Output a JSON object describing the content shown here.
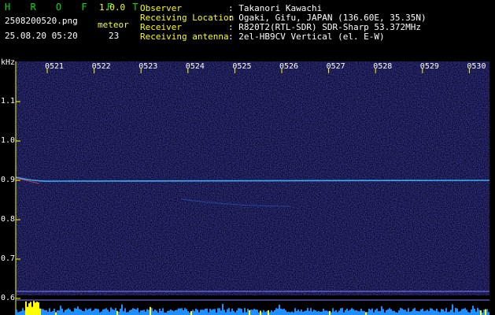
{
  "app": {
    "name": "H R O F F T",
    "version": "1.0.0"
  },
  "file": {
    "name": "2508200520.png",
    "datetime": "25.08.20 05:20"
  },
  "meteor": {
    "label": "meteor",
    "count": "23"
  },
  "info": {
    "labels": [
      "Observer",
      "Receiving Location",
      "Receiver",
      "Receiving antenna"
    ],
    "values": [
      ": Takanori Kawachi",
      ": Ogaki, Gifu, JAPAN (136.60E, 35.35N)",
      ": R820T2(RTL-SDR) SDR-Sharp 53.372MHz",
      ": 2el-HB9CV Vertical (el. E-W)"
    ]
  },
  "waterfall": {
    "unit": "kHz",
    "time_ticks": [
      "0521",
      "0522",
      "0523",
      "0524",
      "0525",
      "0526",
      "0527",
      "0528",
      "0529",
      "0530"
    ],
    "freq_ticks": [
      "1.1",
      "1.0",
      "0.9",
      "0.8",
      "0.7",
      "0.6"
    ],
    "freq_values": [
      1.1,
      1.0,
      0.9,
      0.8,
      0.7,
      0.6
    ],
    "colors": {
      "background": "#000000",
      "noise": "#18186a",
      "carrier": "#3fb0ff",
      "axis": "#ffff00",
      "spectrum": "#1f8fff"
    }
  }
}
